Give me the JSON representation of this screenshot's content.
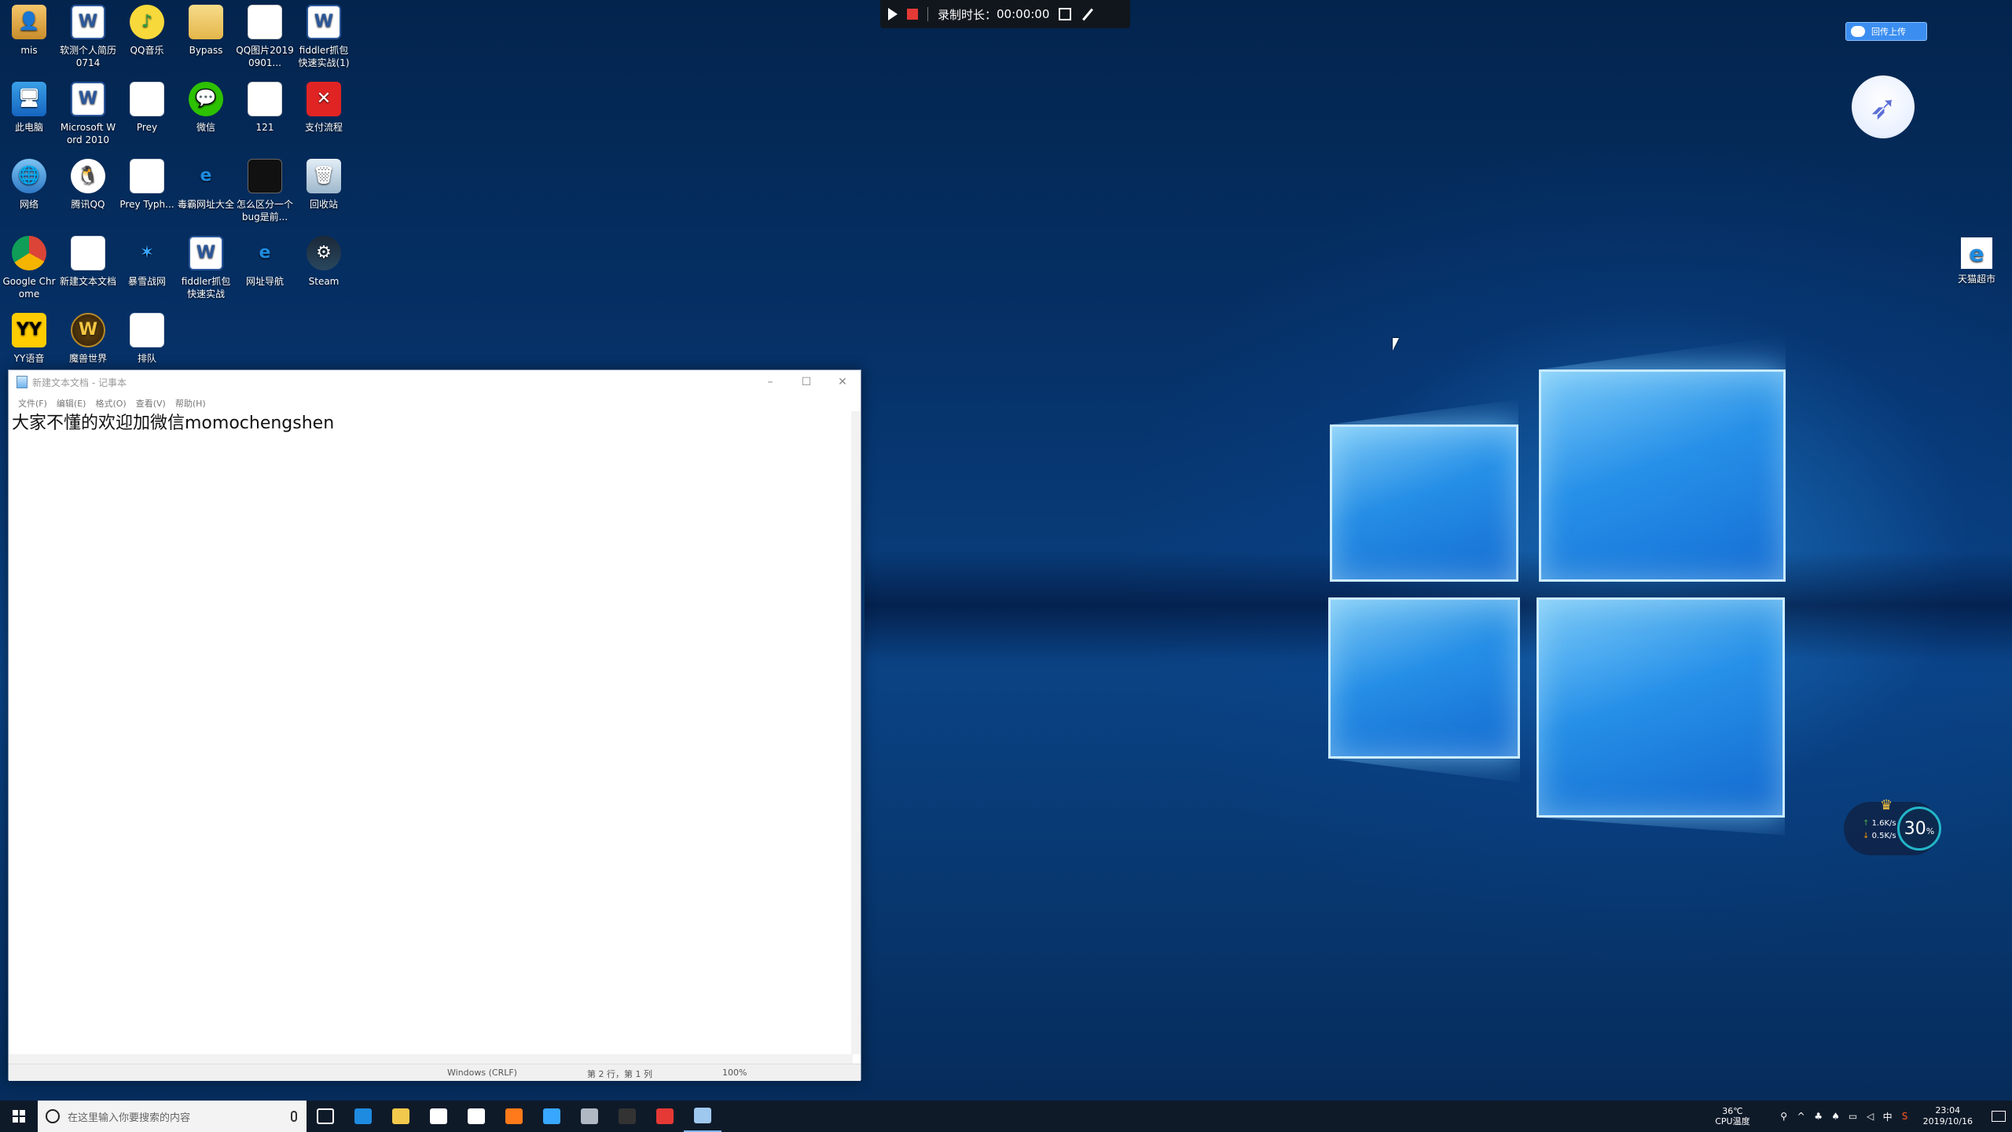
{
  "desktop": {
    "icons": [
      {
        "label": "mis",
        "kind": "user",
        "glyph": "👤"
      },
      {
        "label": "软测个人简历0714",
        "kind": "word",
        "glyph": "W"
      },
      {
        "label": "QQ音乐",
        "kind": "qqmusic",
        "glyph": "♪"
      },
      {
        "label": "Bypass",
        "kind": "folder",
        "glyph": ""
      },
      {
        "label": "QQ图片20190901...",
        "kind": "img",
        "glyph": ""
      },
      {
        "label": "fiddler抓包快速实战(1)",
        "kind": "word",
        "glyph": "W"
      },
      {
        "label": "此电脑",
        "kind": "pc",
        "glyph": "🖥"
      },
      {
        "label": "Microsoft Word 2010",
        "kind": "word",
        "glyph": "W"
      },
      {
        "label": "Prey",
        "kind": "doc",
        "glyph": ""
      },
      {
        "label": "微信",
        "kind": "wechat",
        "glyph": "💬"
      },
      {
        "label": "121",
        "kind": "img",
        "glyph": ""
      },
      {
        "label": "支付流程",
        "kind": "pay",
        "glyph": "✕"
      },
      {
        "label": "网络",
        "kind": "net",
        "glyph": "🌐"
      },
      {
        "label": "腾讯QQ",
        "kind": "qq",
        "glyph": "🐧"
      },
      {
        "label": "Prey Typh...",
        "kind": "doc",
        "glyph": ""
      },
      {
        "label": "毒霸网址大全",
        "kind": "ie",
        "glyph": "e"
      },
      {
        "label": "怎么区分一个bug是前...",
        "kind": "video",
        "glyph": ""
      },
      {
        "label": "回收站",
        "kind": "recycle",
        "glyph": "🗑"
      },
      {
        "label": "Google Chrome",
        "kind": "chrome",
        "glyph": ""
      },
      {
        "label": "新建文本文档",
        "kind": "doc",
        "glyph": ""
      },
      {
        "label": "暴雪战网",
        "kind": "bnet",
        "glyph": "✶"
      },
      {
        "label": "fiddler抓包快速实战",
        "kind": "word",
        "glyph": "W"
      },
      {
        "label": "网址导航",
        "kind": "ie",
        "glyph": "e"
      },
      {
        "label": "Steam",
        "kind": "steam",
        "glyph": "⚙"
      },
      {
        "label": "YY语音",
        "kind": "yy",
        "glyph": "YY"
      },
      {
        "label": "魔兽世界",
        "kind": "wow",
        "glyph": "W"
      },
      {
        "label": "排队",
        "kind": "doc",
        "glyph": ""
      }
    ],
    "right_icon": {
      "label": "天猫超市",
      "glyph": "e"
    }
  },
  "recorder": {
    "label": "录制时长：",
    "time": "00:00:00"
  },
  "cloud_button": {
    "label": "回传上传"
  },
  "netspeed": {
    "up": "1.6K/s",
    "down": "0.5K/s",
    "percent": "30",
    "unit": "%"
  },
  "notepad": {
    "title": "新建文本文档 - 记事本",
    "controls": {
      "minimize": "–",
      "maximize": "☐",
      "close": "✕"
    },
    "menu": [
      "文件(F)",
      "编辑(E)",
      "格式(O)",
      "查看(V)",
      "帮助(H)"
    ],
    "content": "大家不懂的欢迎加微信momochengshen",
    "status": {
      "encoding": "Windows (CRLF)",
      "position": "第 2 行，第 1 列",
      "zoom": "100%"
    }
  },
  "taskbar": {
    "search_placeholder": "在这里输入你要搜索的内容",
    "apps": [
      {
        "name": "task-view",
        "color": "#0f1a29"
      },
      {
        "name": "edge",
        "color": "#1e8be0"
      },
      {
        "name": "file-explorer",
        "color": "#f2c94c"
      },
      {
        "name": "store",
        "color": "#ffffff"
      },
      {
        "name": "mail",
        "color": "#ffffff"
      },
      {
        "name": "firefox",
        "color": "#ff7a1a"
      },
      {
        "name": "battle-net",
        "color": "#38a7ff"
      },
      {
        "name": "globe",
        "color": "#b0b8c4"
      },
      {
        "name": "terminal",
        "color": "#333333"
      },
      {
        "name": "pen",
        "color": "#e53935"
      },
      {
        "name": "notepad",
        "color": "#9fc8ef"
      }
    ],
    "cpu_temp": "36℃",
    "cpu_label": "CPU温度",
    "lang": "中",
    "time": "23:04",
    "date": "2019/10/16"
  }
}
